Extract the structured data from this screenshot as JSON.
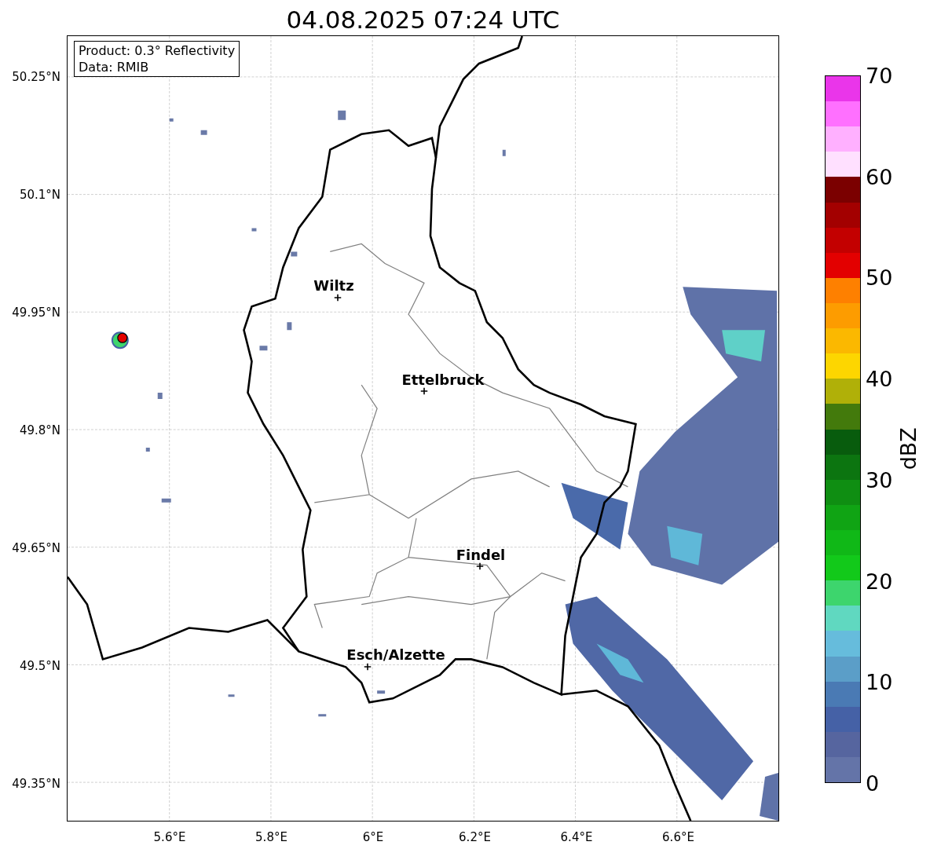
{
  "title": "04.08.2025 07:24 UTC",
  "info_box": [
    "Product: 0.3° Reflectivity",
    "Data: RMIB"
  ],
  "map": {
    "y_ticks": [
      "50.25°N",
      "50.1°N",
      "49.95°N",
      "49.8°N",
      "49.65°N",
      "49.5°N",
      "49.35°N"
    ],
    "x_ticks": [
      "5.6°E",
      "5.8°E",
      "6°E",
      "6.2°E",
      "6.4°E",
      "6.6°E"
    ],
    "cities": [
      {
        "name": "Wiltz"
      },
      {
        "name": "Ettelbruck"
      },
      {
        "name": "Findel"
      },
      {
        "name": "Esch/Alzette"
      }
    ]
  },
  "colorbar": {
    "label": "dBZ",
    "ticks": [
      "70",
      "60",
      "50",
      "40",
      "30",
      "20",
      "10",
      "0"
    ],
    "segments": [
      {
        "color": "#ea35ea"
      },
      {
        "color": "#ff70ff"
      },
      {
        "color": "#ffb0ff"
      },
      {
        "color": "#ffe0ff"
      },
      {
        "color": "#7b0000"
      },
      {
        "color": "#a30000"
      },
      {
        "color": "#c30000"
      },
      {
        "color": "#e30000"
      },
      {
        "color": "#fe8000"
      },
      {
        "color": "#fd9c00"
      },
      {
        "color": "#fbb800"
      },
      {
        "color": "#fdd600"
      },
      {
        "color": "#b0b008"
      },
      {
        "color": "#437a0c"
      },
      {
        "color": "#085c0d"
      },
      {
        "color": "#0c7510"
      },
      {
        "color": "#0f8e12"
      },
      {
        "color": "#10a414"
      },
      {
        "color": "#10b817"
      },
      {
        "color": "#12c91a"
      },
      {
        "color": "#3dd56d"
      },
      {
        "color": "#60d8c0"
      },
      {
        "color": "#66bcdc"
      },
      {
        "color": "#5b9ec8"
      },
      {
        "color": "#4a7ab4"
      },
      {
        "color": "#4561a6"
      },
      {
        "color": "#56659f"
      },
      {
        "color": "#6474a8"
      }
    ]
  }
}
